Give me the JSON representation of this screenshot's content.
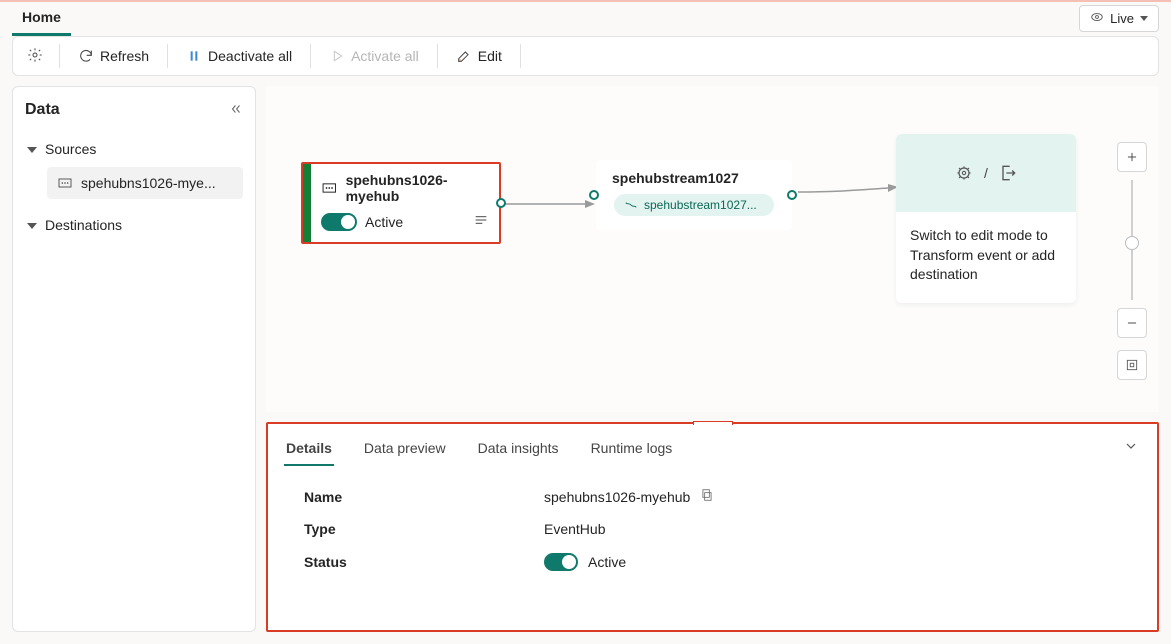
{
  "header": {
    "home_tab": "Home",
    "live_label": "Live"
  },
  "toolbar": {
    "refresh": "Refresh",
    "deactivate_all": "Deactivate all",
    "activate_all": "Activate all",
    "edit": "Edit"
  },
  "sidepanel": {
    "title": "Data",
    "sources_label": "Sources",
    "source_item": "spehubns1026-mye...",
    "destinations_label": "Destinations"
  },
  "canvas": {
    "source_node": {
      "title": "spehubns1026-myehub",
      "status": "Active"
    },
    "stream_node": {
      "title": "spehubstream1027",
      "pill": "spehubstream1027..."
    },
    "dest_node": {
      "slash": "/",
      "message": "Switch to edit mode to Transform event or add destination"
    }
  },
  "details": {
    "tabs": {
      "details": "Details",
      "data_preview": "Data preview",
      "data_insights": "Data insights",
      "runtime_logs": "Runtime logs"
    },
    "fields": {
      "name_label": "Name",
      "name_value": "spehubns1026-myehub",
      "type_label": "Type",
      "type_value": "EventHub",
      "status_label": "Status",
      "status_value": "Active"
    }
  }
}
